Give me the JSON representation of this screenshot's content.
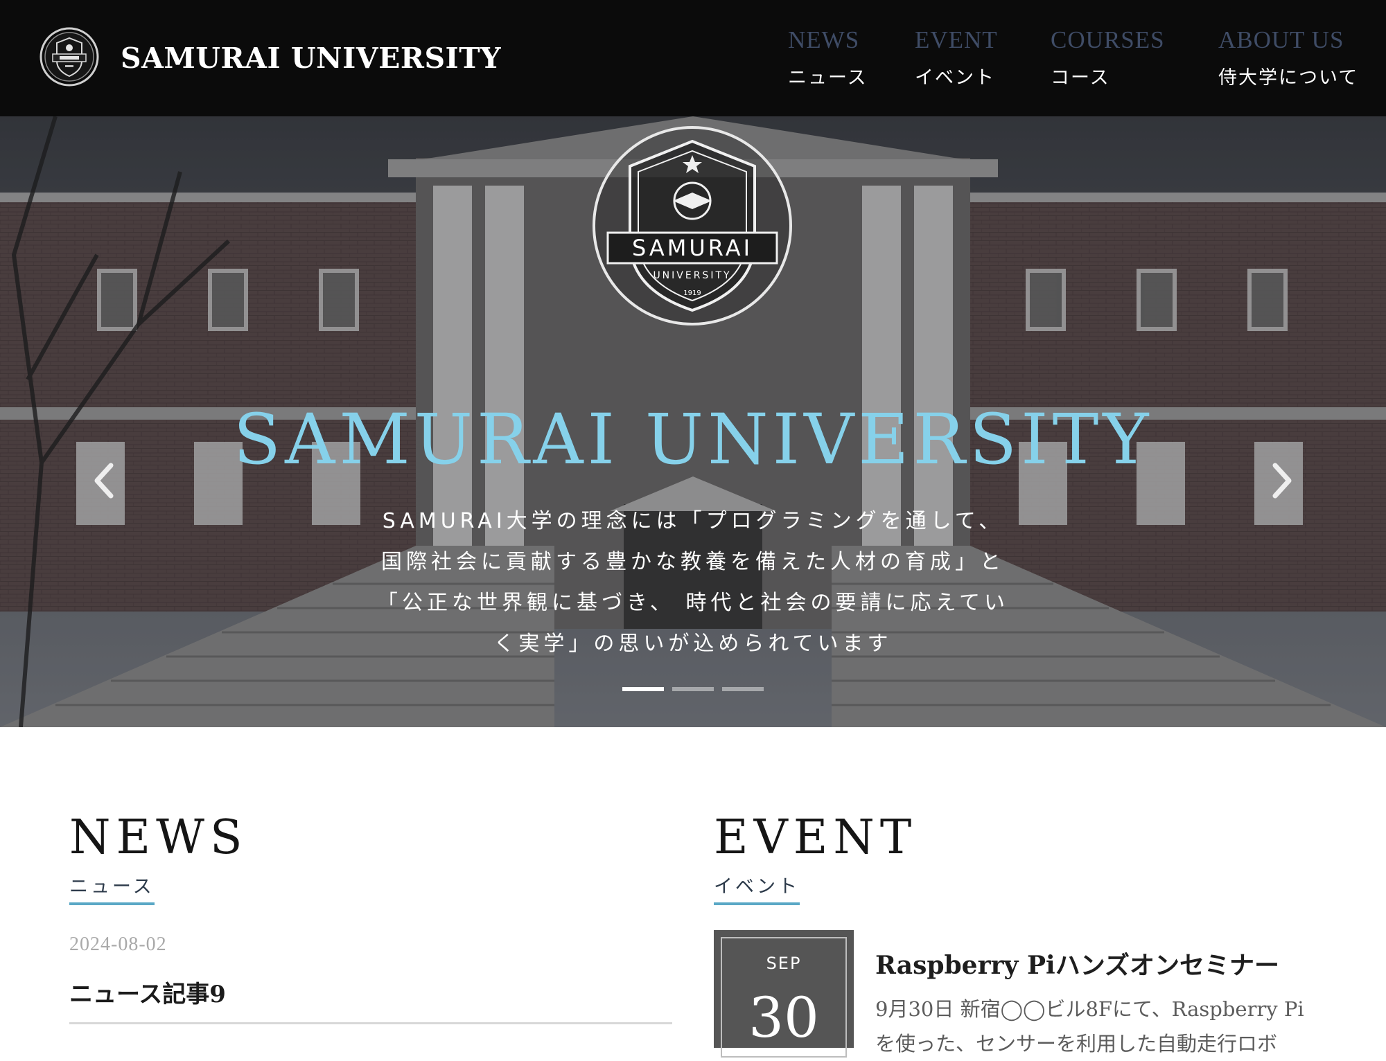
{
  "header": {
    "brand_name": "SAMURAI UNIVERSITY",
    "nav": [
      {
        "en": "NEWS",
        "jp": "ニュース"
      },
      {
        "en": "EVENT",
        "jp": "イベント"
      },
      {
        "en": "COURSES",
        "jp": "コース"
      },
      {
        "en": "ABOUT US",
        "jp": "侍大学について"
      }
    ]
  },
  "hero": {
    "emblem_text": "SAMURAI",
    "emblem_subtext": "UNIVERSITY",
    "emblem_year": "1919",
    "title": "SAMURAI UNIVERSITY",
    "lead": "SAMURAI大学の理念には「プログラミングを通して、 国際社会に貢献する豊かな教養を備えた人材の育成」と 「公正な世界観に基づき、 時代と社会の要請に応えていく実学」の思いが込められています",
    "slides_total": 3,
    "slide_active": 1
  },
  "news": {
    "title": "NEWS",
    "subtitle": "ニュース",
    "items": [
      {
        "date": "2024-08-02",
        "title": "ニュース記事9"
      }
    ]
  },
  "event": {
    "title": "EVENT",
    "subtitle": "イベント",
    "items": [
      {
        "month": "SEP",
        "day": "30",
        "title": "Raspberry Piハンズオンセミナー",
        "desc": "9月30日 新宿◯◯ビル8Fにて、Raspberry Piを使った、センサーを利用した自動走行ロボ"
      }
    ]
  },
  "colors": {
    "header_bg": "#0b0b0b",
    "nav_en": "#3f4c66",
    "hero_title": "#86d1ea",
    "accent_underline": "#5aa8c6",
    "event_box": "#555555"
  }
}
